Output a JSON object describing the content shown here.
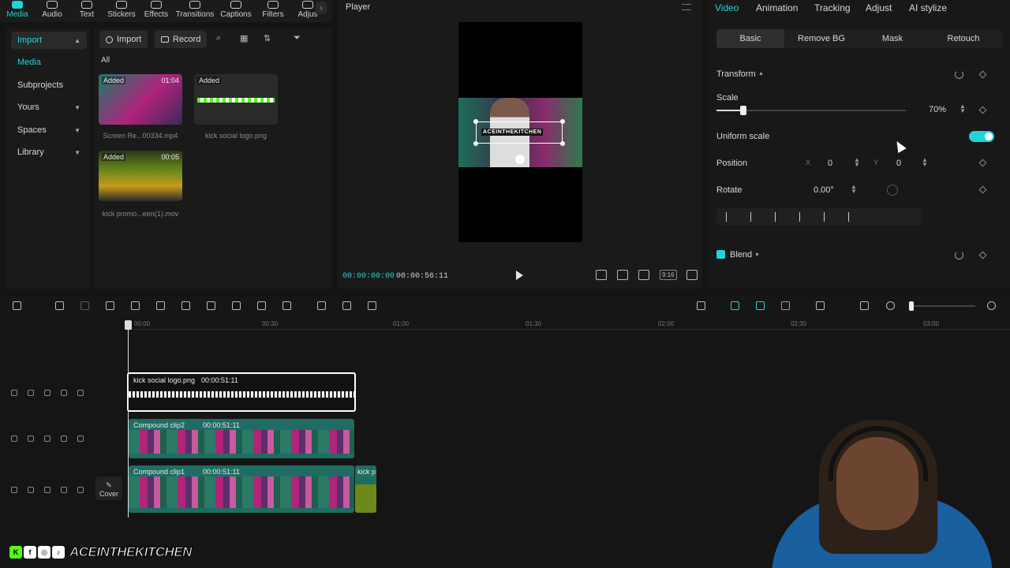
{
  "toolbar": {
    "tabs": [
      {
        "label": "Media",
        "icon": "media-icon"
      },
      {
        "label": "Audio",
        "icon": "audio-icon"
      },
      {
        "label": "Text",
        "icon": "text-icon"
      },
      {
        "label": "Stickers",
        "icon": "stickers-icon"
      },
      {
        "label": "Effects",
        "icon": "effects-icon"
      },
      {
        "label": "Transitions",
        "icon": "transitions-icon"
      },
      {
        "label": "Captions",
        "icon": "captions-icon"
      },
      {
        "label": "Filters",
        "icon": "filters-icon"
      },
      {
        "label": "Adjus",
        "icon": "adjust-icon"
      }
    ],
    "more": "›"
  },
  "sidebar": {
    "items": [
      {
        "label": "Import"
      },
      {
        "label": "Media"
      },
      {
        "label": "Subprojects"
      },
      {
        "label": "Yours"
      },
      {
        "label": "Spaces"
      },
      {
        "label": "Library"
      }
    ]
  },
  "media": {
    "import_label": "Import",
    "record_label": "Record",
    "filter_label": "All",
    "items": [
      {
        "badge": "Added",
        "duration": "01:04",
        "name": "Screen Re...00334.mp4"
      },
      {
        "badge": "Added",
        "duration": "",
        "name": "kick social logo.png"
      },
      {
        "badge": "Added",
        "duration": "00:05",
        "name": "kick promo...een(1).mov"
      }
    ]
  },
  "player": {
    "title": "Player",
    "current_time": "00:00:00:00",
    "total_time": "00:00:56:11",
    "logo_text": "ACEINTHEKITCHEN",
    "ratio_label": "9:16"
  },
  "inspector": {
    "tabs": [
      "Video",
      "Animation",
      "Tracking",
      "Adjust",
      "AI stylize"
    ],
    "subtabs": [
      "Basic",
      "Remove BG",
      "Mask",
      "Retouch"
    ],
    "transform_label": "Transform",
    "scale_label": "Scale",
    "scale_value": "70%",
    "scale_fraction": 0.14,
    "uniform_label": "Uniform scale",
    "position_label": "Position",
    "pos_x_label": "X",
    "pos_x": "0",
    "pos_y_label": "Y",
    "pos_y": "0",
    "rotate_label": "Rotate",
    "rotate_value": "0.00°",
    "blend_label": "Blend",
    "accent": "#22d3d7"
  },
  "timeline": {
    "ruler": [
      "00:00",
      "00:30",
      "01:00",
      "01:30",
      "02:00",
      "02:30",
      "03:00"
    ],
    "clips": [
      {
        "title": "kick social logo.png",
        "duration": "00:00:51:11"
      },
      {
        "title": "Compound clip2",
        "duration": "00:00:51:11"
      },
      {
        "title": "Compound clip1",
        "duration": "00:00:51:11"
      },
      {
        "title": "kick p",
        "duration": ""
      }
    ],
    "cover_label": "Cover"
  },
  "watermark": {
    "text": "ACEINTHEKITCHEN",
    "icons": [
      "K",
      "f",
      "◎",
      "♪"
    ]
  }
}
